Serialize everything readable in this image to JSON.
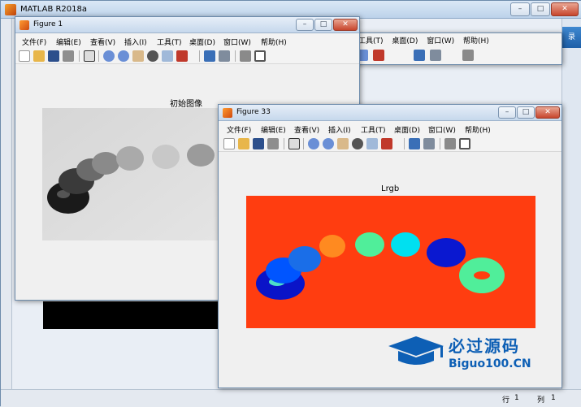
{
  "main_window": {
    "title": "MATLAB R2018a",
    "controls": [
      "–",
      "□",
      "✕"
    ],
    "right_edge_text": "录",
    "status": {
      "row_label": "行",
      "row": "1",
      "col_label": "列",
      "col": "1"
    }
  },
  "figure1": {
    "title": "Figure 1",
    "controls": [
      "–",
      "□",
      "✕"
    ],
    "menu": [
      "文件(F)",
      "编辑(E)",
      "查看(V)",
      "插入(I)",
      "工具(T)",
      "桌面(D)",
      "窗口(W)",
      "帮助(H)"
    ],
    "axes_title": "初始图像"
  },
  "figure_behind": {
    "menu": [
      "工具(T)",
      "桌面(D)",
      "窗口(W)",
      "帮助(H)"
    ]
  },
  "figure33": {
    "title": "Figure 33",
    "controls": [
      "–",
      "□",
      "✕"
    ],
    "menu": [
      "文件(F)",
      "编辑(E)",
      "查看(V)",
      "插入(I)",
      "工具(T)",
      "桌面(D)",
      "窗口(W)",
      "帮助(H)"
    ],
    "axes_title": "Lrgb"
  },
  "toolbar_icons": [
    "new-file-icon",
    "open-folder-icon",
    "save-icon",
    "print-icon",
    "pointer-icon",
    "zoom-in-icon",
    "zoom-out-icon",
    "pan-icon",
    "rotate-icon",
    "data-cursor-icon",
    "brush-icon",
    "colorbar-icon",
    "legend-icon",
    "hide-plot-tools-icon",
    "show-plot-tools-icon"
  ],
  "colors": {
    "label_background": "#ff3d10",
    "watermark": "#0d5fb5"
  },
  "watermark": {
    "chinese": "必过源码",
    "english": "Biguo100.CN"
  }
}
